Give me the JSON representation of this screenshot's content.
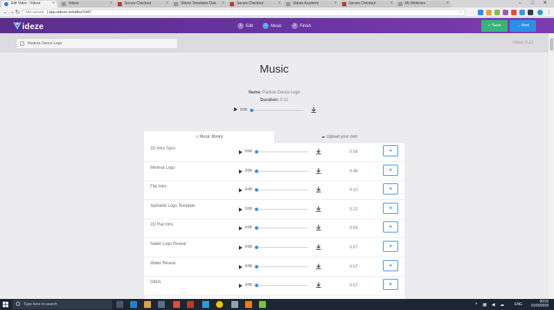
{
  "browser": {
    "tabs": [
      {
        "label": "Edit Video - Videze",
        "fav": "v",
        "active": true
      },
      {
        "label": "Videze",
        "fav": "g",
        "active": false
      },
      {
        "label": "Secure Checkout",
        "fav": "r",
        "active": false
      },
      {
        "label": "Videze Templates Club",
        "fav": "g",
        "active": false
      },
      {
        "label": "Secure Checkout",
        "fav": "r",
        "active": false
      },
      {
        "label": "Videze Academy",
        "fav": "g",
        "active": false
      },
      {
        "label": "Secure Checkout",
        "fav": "r",
        "active": false
      },
      {
        "label": "My Webinars",
        "fav": "g",
        "active": false
      }
    ],
    "not_secure": "Not secure",
    "url": "app.videze.io/editor/1447"
  },
  "app": {
    "logo": "ideze",
    "steps": [
      {
        "num": "1",
        "label": "Edit"
      },
      {
        "num": "2",
        "label": "Music"
      },
      {
        "num": "3",
        "label": "Finish"
      }
    ],
    "save_label": "Save",
    "next_label": "Next",
    "title_value": "Particle Dance Logo",
    "video_id": "Video: 0.12"
  },
  "music": {
    "heading": "Music",
    "name_label": "Name:",
    "name_value": "Particle Dance Logo",
    "duration_label": "Duration:",
    "duration_value": "0:12",
    "player_time": "0:00",
    "tabs": [
      {
        "label": "Music library",
        "icon": "music-note-icon"
      },
      {
        "label": "Upload your own",
        "icon": "cloud-upload-icon"
      }
    ],
    "tracks": [
      {
        "name": "2D Intro Sync",
        "time": "0:00",
        "duration": "0:09"
      },
      {
        "name": "Minimal Logo",
        "time": "0:00",
        "duration": "0:46"
      },
      {
        "name": "Flat Intro",
        "time": "0:00",
        "duration": "0:10"
      },
      {
        "name": "Alphabet Logo Template",
        "time": "0:00",
        "duration": "0:22"
      },
      {
        "name": "2D Flat Intro",
        "time": "0:00",
        "duration": "0:09"
      },
      {
        "name": "Saber Logo Reveal",
        "time": "0:00",
        "duration": "0:07"
      },
      {
        "name": "Water Reveal",
        "time": "0:00",
        "duration": "0:07"
      },
      {
        "name": "Glitch",
        "time": "0:00",
        "duration": "0:07"
      }
    ]
  },
  "taskbar": {
    "search_placeholder": "Type here to search",
    "lang": "ENG",
    "time": "00:02",
    "date": "01/03/2018"
  },
  "colors": {
    "header_start": "#5b2d8d",
    "header_end": "#7d3cb3",
    "save": "#39b37a",
    "next": "#2b8fe6",
    "accent": "#3a8ee6"
  }
}
